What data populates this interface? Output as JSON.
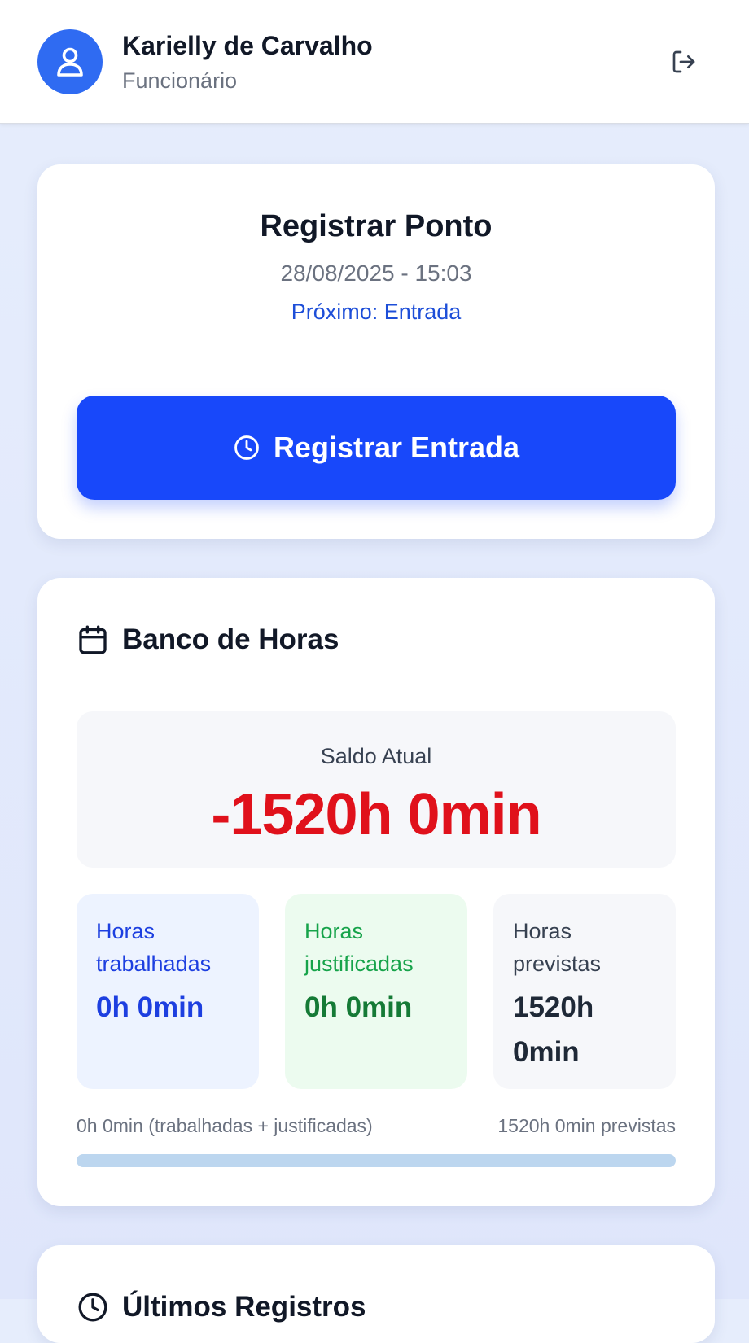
{
  "header": {
    "user_name": "Karielly de Carvalho",
    "user_role": "Funcionário",
    "avatar_icon": "user-icon",
    "logout_icon": "logout-icon"
  },
  "ponto": {
    "title": "Registrar Ponto",
    "datetime": "28/08/2025 - 15:03",
    "next": "Próximo: Entrada",
    "button_label": "Registrar Entrada",
    "button_icon": "clock-icon"
  },
  "banco": {
    "title": "Banco de Horas",
    "icon": "calendar-icon",
    "saldo_label": "Saldo Atual",
    "saldo_value": "-1520h 0min",
    "stats": [
      {
        "label": "Horas trabalhadas",
        "value": "0h 0min"
      },
      {
        "label": "Horas justificadas",
        "value": "0h 0min"
      },
      {
        "label": "Horas previstas",
        "value": "1520h 0min"
      }
    ],
    "progress_left": "0h 0min (trabalhadas + justificadas)",
    "progress_right": "1520h 0min previstas",
    "progress_fraction": 0
  },
  "ultimos": {
    "title": "Últimos Registros",
    "icon": "clock-icon"
  },
  "colors": {
    "primary": "#1848fa",
    "negative": "#e0111b",
    "worked": "#1d3fe0",
    "justified": "#157a36"
  }
}
